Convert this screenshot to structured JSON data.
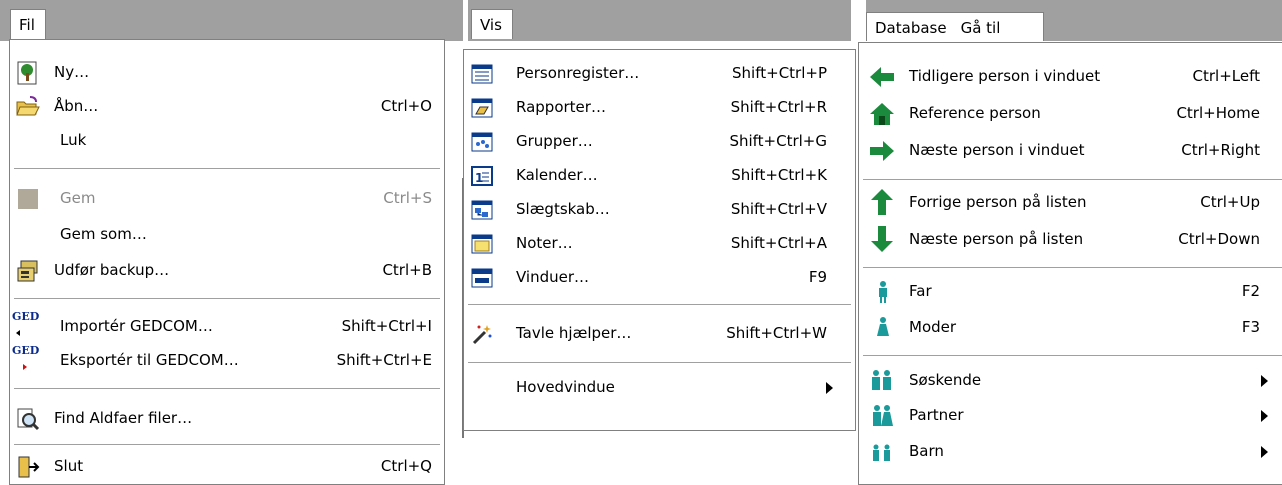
{
  "fil": {
    "title": "Fil",
    "items": [
      {
        "label": "Ny…",
        "shortcut": "",
        "icon": "tree-document-icon"
      },
      {
        "label": "Åbn…",
        "shortcut": "Ctrl+O",
        "icon": "open-folder-icon"
      },
      {
        "label": "Luk",
        "shortcut": "",
        "icon": ""
      },
      {
        "label": "Gem",
        "shortcut": "Ctrl+S",
        "icon": "save-icon",
        "disabled": true
      },
      {
        "label": "Gem som…",
        "shortcut": "",
        "icon": ""
      },
      {
        "label": "Udfør backup…",
        "shortcut": "Ctrl+B",
        "icon": "backup-icon"
      },
      {
        "label": "Importér GEDCOM…",
        "shortcut": "Shift+Ctrl+I",
        "icon": "ged-import-icon"
      },
      {
        "label": "Eksportér til GEDCOM…",
        "shortcut": "Shift+Ctrl+E",
        "icon": "ged-export-icon"
      },
      {
        "label": "Find Aldfaer filer…",
        "shortcut": "",
        "icon": "find-files-icon"
      },
      {
        "label": "Slut",
        "shortcut": "Ctrl+Q",
        "icon": "exit-door-icon"
      }
    ]
  },
  "vis": {
    "title": "Vis",
    "items": [
      {
        "label": "Personregister…",
        "shortcut": "Shift+Ctrl+P",
        "icon": "person-register-icon"
      },
      {
        "label": "Rapporter…",
        "shortcut": "Shift+Ctrl+R",
        "icon": "reports-icon"
      },
      {
        "label": "Grupper…",
        "shortcut": "Shift+Ctrl+G",
        "icon": "groups-icon"
      },
      {
        "label": "Kalender…",
        "shortcut": "Shift+Ctrl+K",
        "icon": "calendar-icon"
      },
      {
        "label": "Slægtskab…",
        "shortcut": "Shift+Ctrl+V",
        "icon": "relationship-icon"
      },
      {
        "label": "Noter…",
        "shortcut": "Shift+Ctrl+A",
        "icon": "notes-icon"
      },
      {
        "label": "Vinduer…",
        "shortcut": "F9",
        "icon": "windows-icon"
      },
      {
        "label": "Tavle hjælper…",
        "shortcut": "Shift+Ctrl+W",
        "icon": "magic-wand-icon"
      },
      {
        "label": "Hovedvindue",
        "shortcut": "",
        "icon": ""
      }
    ]
  },
  "database": {
    "menus": [
      "Database",
      "Gå til"
    ],
    "items": [
      {
        "label": "Tidligere person i vinduet",
        "shortcut": "Ctrl+Left",
        "icon": "arrow-left-icon"
      },
      {
        "label": "Reference person",
        "shortcut": "Ctrl+Home",
        "icon": "home-icon"
      },
      {
        "label": "Næste person i vinduet",
        "shortcut": "Ctrl+Right",
        "icon": "arrow-right-icon"
      },
      {
        "label": "Forrige person på listen",
        "shortcut": "Ctrl+Up",
        "icon": "arrow-up-icon"
      },
      {
        "label": "Næste person på listen",
        "shortcut": "Ctrl+Down",
        "icon": "arrow-down-icon"
      },
      {
        "label": "Far",
        "shortcut": "F2",
        "icon": "father-icon"
      },
      {
        "label": "Moder",
        "shortcut": "F3",
        "icon": "mother-icon"
      },
      {
        "label": "Søskende",
        "shortcut": "",
        "icon": "siblings-icon"
      },
      {
        "label": "Partner",
        "shortcut": "",
        "icon": "partner-icon"
      },
      {
        "label": "Barn",
        "shortcut": "",
        "icon": "child-icon"
      }
    ]
  },
  "colors": {
    "bar": "#a0a0a0",
    "icon_green": "#1c8a3c",
    "icon_teal": "#1a9a9a"
  }
}
